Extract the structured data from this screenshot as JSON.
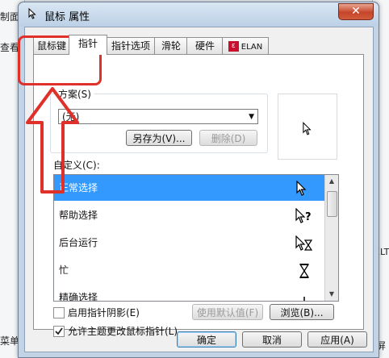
{
  "background": {
    "left_texts": [
      "制面",
      "查看(",
      "菜单"
    ],
    "right_texts": [
      "ELT",
      "屏"
    ]
  },
  "dialog": {
    "title": "鼠标 属性",
    "close_glyph": "✕"
  },
  "tabs": [
    {
      "label": "鼠标键"
    },
    {
      "label": "指针"
    },
    {
      "label": "指针选项"
    },
    {
      "label": "滑轮"
    },
    {
      "label": "硬件"
    },
    {
      "label": "ELAN"
    }
  ],
  "scheme": {
    "label": "方案(S)",
    "value": "(无)",
    "save_as_label": "另存为(V)...",
    "delete_label": "删除(D)"
  },
  "customize": {
    "label": "自定义(C):",
    "items": [
      {
        "label": "正常选择",
        "icon": "arrow-cursor-icon",
        "selected": true
      },
      {
        "label": "帮助选择",
        "icon": "help-cursor-icon",
        "selected": false
      },
      {
        "label": "后台运行",
        "icon": "working-cursor-icon",
        "selected": false
      },
      {
        "label": "忙",
        "icon": "busy-cursor-icon",
        "selected": false
      },
      {
        "label": "精确选择",
        "icon": "precision-cursor-icon",
        "selected": false
      }
    ]
  },
  "options": {
    "shadow_label": "启用指针阴影(E)",
    "shadow_checked": false,
    "use_default_label": "使用默认值(F)",
    "browse_label": "浏览(B)...",
    "allow_theme_label": "允许主题更改鼠标指针(L)",
    "allow_theme_checked": true
  },
  "buttons": {
    "ok_label": "确定",
    "cancel_label": "取消",
    "apply_label": "应用(A)"
  },
  "colors": {
    "selection": "#3399ff",
    "annotation": "#e0302a"
  }
}
